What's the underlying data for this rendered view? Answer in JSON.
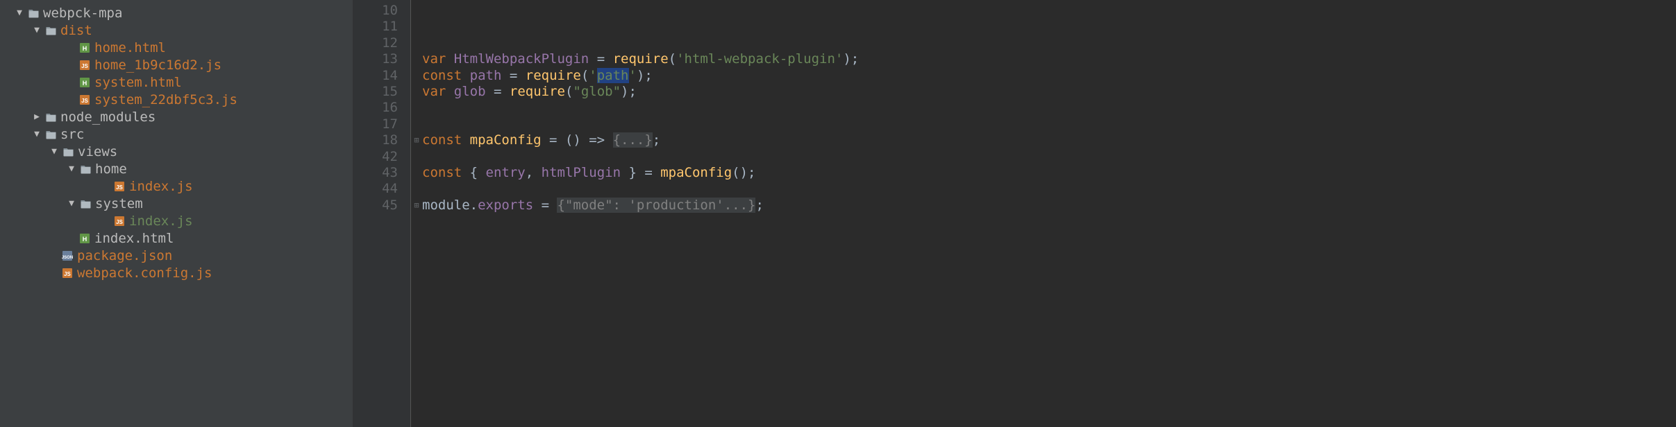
{
  "tree": [
    {
      "indent": 20,
      "arrow": "▼",
      "icon": "folder",
      "name": "webpck-mpa",
      "color": "grey"
    },
    {
      "indent": 45,
      "arrow": "▼",
      "icon": "folder",
      "name": "dist",
      "color": "orange"
    },
    {
      "indent": 94,
      "arrow": "",
      "icon": "html",
      "name": "home.html",
      "color": "orange"
    },
    {
      "indent": 94,
      "arrow": "",
      "icon": "js",
      "name": "home_1b9c16d2.js",
      "color": "orange"
    },
    {
      "indent": 94,
      "arrow": "",
      "icon": "html",
      "name": "system.html",
      "color": "orange"
    },
    {
      "indent": 94,
      "arrow": "",
      "icon": "js",
      "name": "system_22dbf5c3.js",
      "color": "orange"
    },
    {
      "indent": 45,
      "arrow": "▶",
      "icon": "folder",
      "name": "node_modules",
      "color": "grey"
    },
    {
      "indent": 45,
      "arrow": "▼",
      "icon": "folder",
      "name": "src",
      "color": "grey"
    },
    {
      "indent": 70,
      "arrow": "▼",
      "icon": "folder",
      "name": "views",
      "color": "grey"
    },
    {
      "indent": 95,
      "arrow": "▼",
      "icon": "folder",
      "name": "home",
      "color": "grey"
    },
    {
      "indent": 144,
      "arrow": "",
      "icon": "js",
      "name": "index.js",
      "color": "orange"
    },
    {
      "indent": 95,
      "arrow": "▼",
      "icon": "folder",
      "name": "system",
      "color": "grey"
    },
    {
      "indent": 144,
      "arrow": "",
      "icon": "js",
      "name": "index.js",
      "color": "green"
    },
    {
      "indent": 94,
      "arrow": "",
      "icon": "html",
      "name": "index.html",
      "color": "grey"
    },
    {
      "indent": 69,
      "arrow": "",
      "icon": "json",
      "name": "package.json",
      "color": "orange"
    },
    {
      "indent": 69,
      "arrow": "",
      "icon": "js",
      "name": "webpack.config.js",
      "color": "orange"
    }
  ],
  "gutter_lines": [
    "10",
    "11",
    "12",
    "13",
    "14",
    "15",
    "16",
    "17",
    "18",
    "42",
    "43",
    "44",
    "45"
  ],
  "fold_markers": {
    "8": "⊞",
    "12": "⊞"
  },
  "code": {
    "l10": "",
    "l11": "",
    "l12": "",
    "l13": {
      "pre": "",
      "k1": "var",
      "sp1": " ",
      "v1": "HtmlWebpackPlugin",
      "eq": " = ",
      "fn": "require",
      "po": "(",
      "s": "'html-webpack-plugin'",
      "pc": ");"
    },
    "l14": {
      "pre": "",
      "k1": "const",
      "sp1": " ",
      "v1": "path",
      "eq": " = ",
      "fn": "require",
      "po": "(",
      "s1": "'",
      "hl": "path",
      "s2": "'",
      "pc": ");"
    },
    "l15": {
      "pre": "",
      "k1": "var",
      "sp1": " ",
      "v1": "glob",
      "eq": " = ",
      "fn": "require",
      "po": "(",
      "s": "\"glob\"",
      "pc": ");"
    },
    "l16": "",
    "l17": "",
    "l18": {
      "k1": "const",
      "sp1": " ",
      "fn": "mpaConfig",
      "eq": " = () => ",
      "fold": "{...}",
      "sc": ";"
    },
    "l42": "",
    "l43": {
      "pre": "",
      "k1": "const",
      "sp1": " { ",
      "v1": "entry",
      "c": ", ",
      "v2": "htmlPlugin",
      "sp2": " } = ",
      "fn": "mpaConfig",
      "pc": "();"
    },
    "l44": "",
    "l45": {
      "t1": "module.",
      "v1": "exports",
      "eq": " = ",
      "fold": "{\"mode\": 'production'...}",
      "sc": ";"
    }
  }
}
